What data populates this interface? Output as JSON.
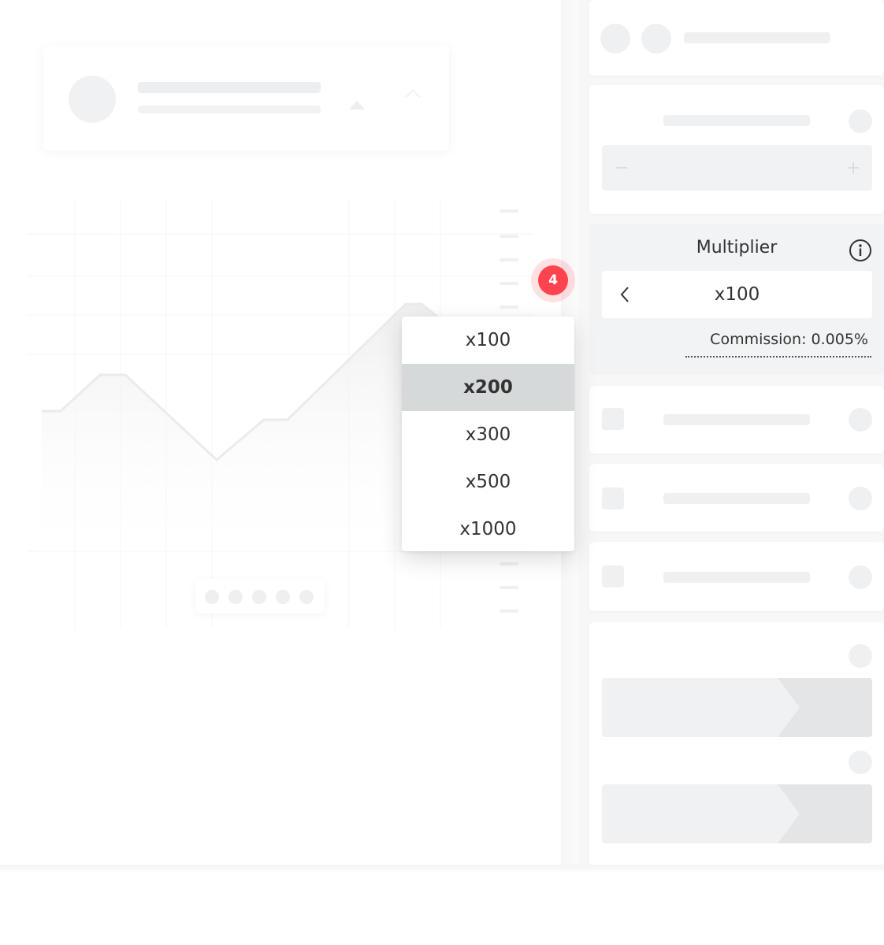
{
  "tutorial": {
    "step_number": "4"
  },
  "multiplier": {
    "title": "Multiplier",
    "selected_value": "x100",
    "commission": "Commission: 0.005%",
    "options": [
      {
        "label": "x100",
        "highlighted": false
      },
      {
        "label": "x200",
        "highlighted": true
      },
      {
        "label": "x300",
        "highlighted": false
      },
      {
        "label": "x500",
        "highlighted": false
      },
      {
        "label": "x1000",
        "highlighted": false
      }
    ]
  },
  "icons": {
    "info": "info-icon",
    "back": "chevron-left-icon",
    "minus": "minus-icon",
    "plus": "plus-icon"
  },
  "colors": {
    "badge": "#ff444f",
    "highlight": "#d6d9da",
    "panel": "#f2f3f4"
  }
}
